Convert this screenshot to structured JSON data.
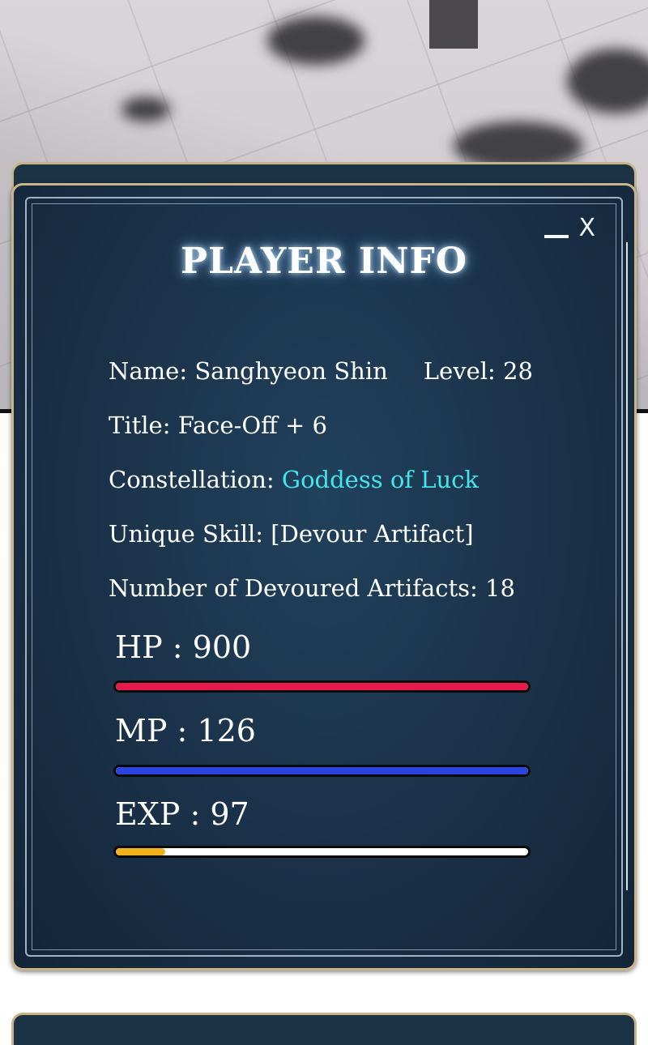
{
  "window": {
    "title": "PLAYER INFO",
    "minimize_icon": "minimize-icon",
    "close_label": "X"
  },
  "player": {
    "name_label": "Name: Sanghyeon Shin",
    "level_label": "Level: 28",
    "title_label": "Title: Face-Off + 6",
    "constellation_prefix": "Constellation: ",
    "constellation_value": "Goddess of Luck",
    "unique_skill_label": "Unique Skill: [Devour Artifact]",
    "devoured_label": "Number of Devoured Artifacts: 18"
  },
  "stats": {
    "hp": {
      "label": "HP : 900",
      "fill_fraction": 1.0,
      "color": "#e8194c"
    },
    "mp": {
      "label": "MP : 126",
      "fill_fraction": 1.0,
      "color": "#2b43e0"
    },
    "exp": {
      "label": "EXP : 97",
      "fill_fraction": 0.12,
      "color": "#f0b21a"
    }
  },
  "colors": {
    "panel_bg": "#1a3148",
    "panel_border": "#c9b48a",
    "constellation": "#45e3ea",
    "text": "#ffffff"
  }
}
